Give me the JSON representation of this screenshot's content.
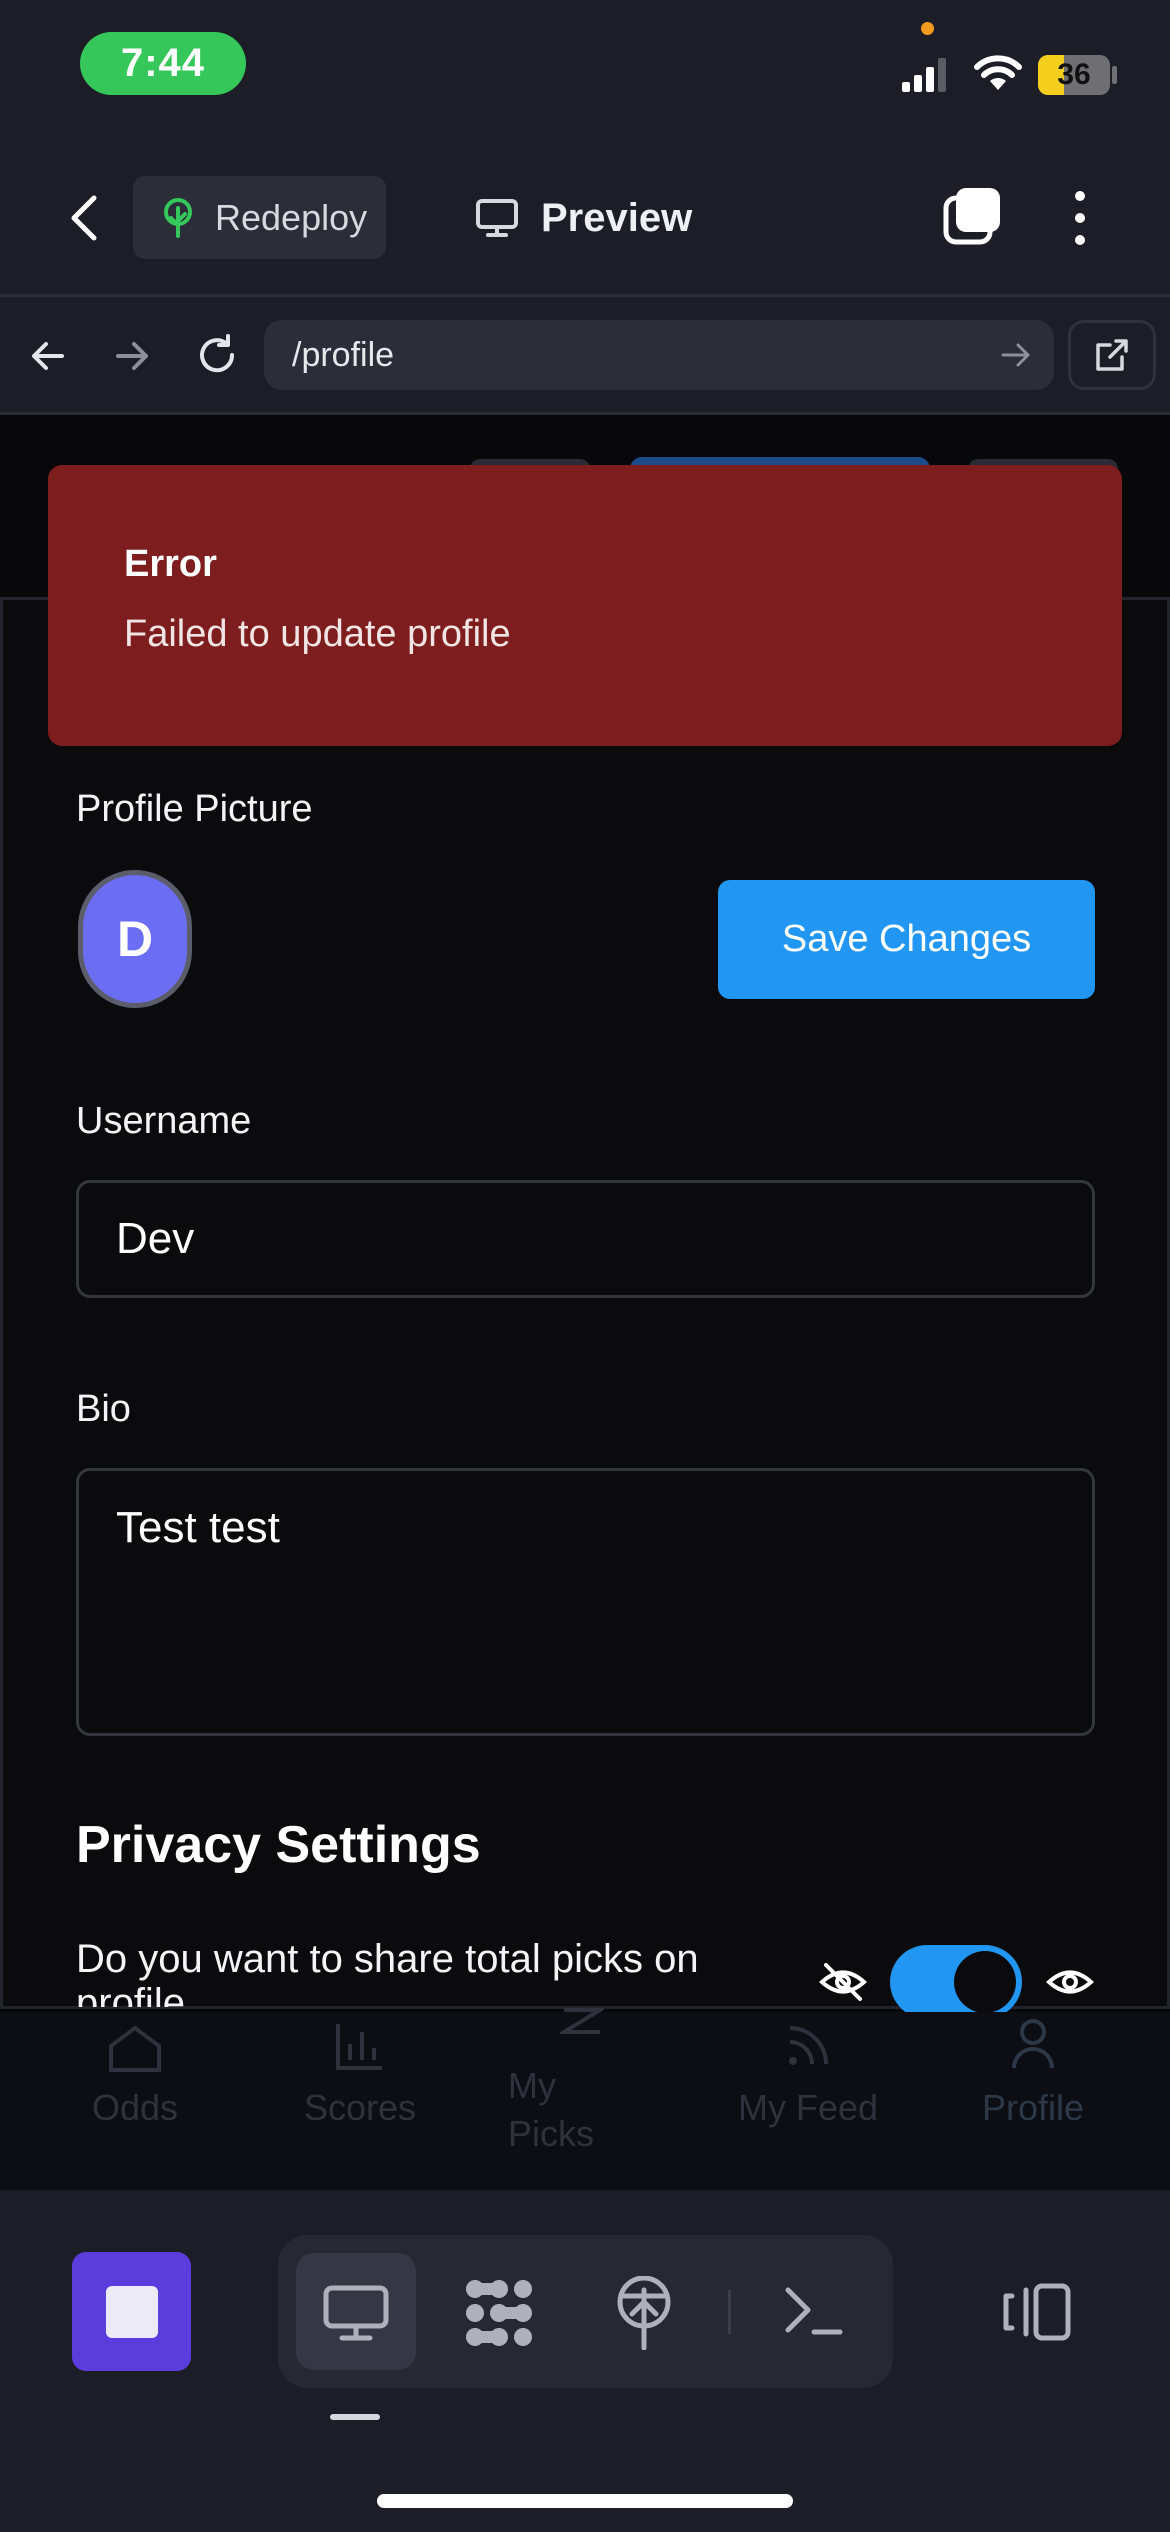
{
  "status_bar": {
    "time": "7:44",
    "battery": "36",
    "battery_level": 0.36,
    "icons": [
      "signal-icon",
      "wifi-icon",
      "battery-charging-icon"
    ]
  },
  "app_header": {
    "redeploy_label": "Redeploy",
    "preview_label": "Preview",
    "icons": [
      "back-icon",
      "tree-icon",
      "monitor-icon",
      "tabs-icon",
      "more-icon"
    ]
  },
  "browser": {
    "url": "/profile"
  },
  "toast": {
    "title": "Error",
    "message": "Failed to update profile"
  },
  "profile": {
    "picture_label": "Profile Picture",
    "avatar_initial": "D",
    "save_label": "Save Changes",
    "username_label": "Username",
    "username_value": "Dev",
    "bio_label": "Bio",
    "bio_value": "Test test"
  },
  "privacy": {
    "title": "Privacy Settings",
    "question": "Do you want to share total picks on profile",
    "toggle_on": true
  },
  "web_nav": {
    "items": [
      {
        "label": "Odds",
        "icon": "home-icon"
      },
      {
        "label": "Scores",
        "icon": "bar-chart-icon"
      },
      {
        "label": "My Picks",
        "icon": "hourglass-icon"
      },
      {
        "label": "My Feed",
        "icon": "rss-icon"
      },
      {
        "label": "Profile",
        "icon": "user-icon"
      }
    ]
  },
  "toolbar": {
    "icons": [
      "stop-icon",
      "monitor-icon",
      "nodes-icon",
      "deploy-icon",
      "terminal-icon",
      "panel-toggle-icon"
    ]
  },
  "colors": {
    "accent": "#2196f3",
    "error": "#7e1d1e",
    "avatar": "#6b6ef2",
    "stop": "#5b3ddc"
  }
}
